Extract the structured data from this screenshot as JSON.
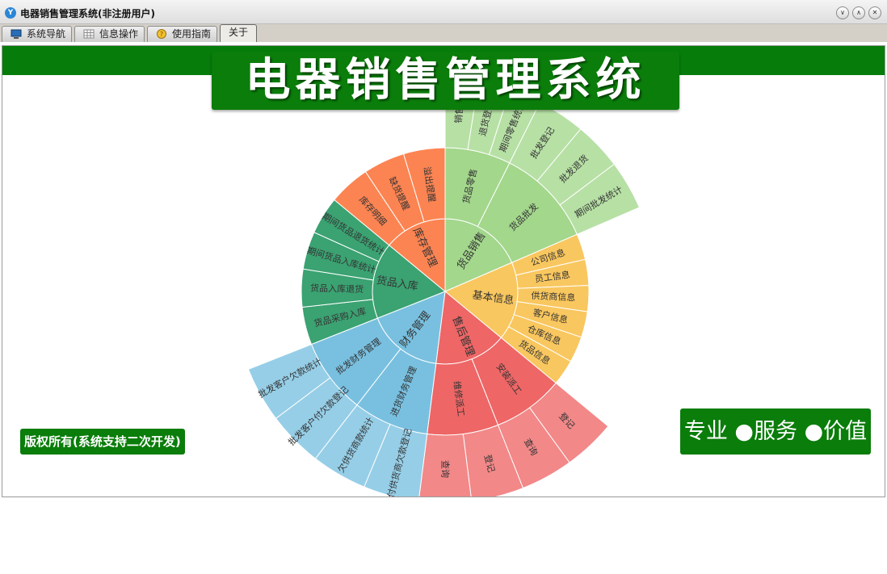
{
  "window": {
    "title": "电器销售管理系统(非注册用户)"
  },
  "tabs": [
    {
      "label": "系统导航",
      "icon": "monitor-icon"
    },
    {
      "label": "信息操作",
      "icon": "grid-icon"
    },
    {
      "label": "使用指南",
      "icon": "help-icon"
    },
    {
      "label": "关于",
      "icon": ""
    }
  ],
  "banner": {
    "title": "电器销售管理系统"
  },
  "footer": {
    "copyright": "版权所有(系统支持二次开发)",
    "slogan": "专业 ●服务 ●价值"
  },
  "colors": {
    "brand_green": "#0a7d0a"
  },
  "chart_data": {
    "type": "sunburst",
    "title": "",
    "levels": [
      {
        "name": "货品销售",
        "color": "#a3d78c",
        "share": 0.185,
        "children": [
          {
            "name": "货品零售",
            "share": 0.4,
            "children": [
              {
                "name": "销售",
                "share": 0.34
              },
              {
                "name": "退货登记",
                "share": 0.33
              },
              {
                "name": "期间零售统计",
                "share": 0.33
              }
            ]
          },
          {
            "name": "货品批发",
            "share": 0.6,
            "children": [
              {
                "name": "批发登记",
                "share": 0.33
              },
              {
                "name": "批发退货",
                "share": 0.33
              },
              {
                "name": "期间批发统计",
                "share": 0.34
              }
            ]
          }
        ]
      },
      {
        "name": "基本信息",
        "color": "#f9c75f",
        "share": 0.175,
        "children": [
          {
            "name": "公司信息"
          },
          {
            "name": "员工信息"
          },
          {
            "name": "供货商信息"
          },
          {
            "name": "客户信息"
          },
          {
            "name": "仓库信息"
          },
          {
            "name": "货品信息"
          }
        ]
      },
      {
        "name": "售后管理",
        "color": "#ee6666",
        "share": 0.16,
        "children": [
          {
            "name": "安装派工",
            "share": 0.5,
            "children": [
              {
                "name": "登记"
              },
              {
                "name": "查询"
              }
            ]
          },
          {
            "name": "维修派工",
            "share": 0.5,
            "children": [
              {
                "name": "登记"
              },
              {
                "name": "查询"
              }
            ]
          }
        ]
      },
      {
        "name": "财务管理",
        "color": "#79c0e0",
        "share": 0.17,
        "children": [
          {
            "name": "进货财务管理",
            "share": 0.5,
            "children": [
              {
                "name": "付供货商欠款登记"
              },
              {
                "name": "欠供货商款统计"
              }
            ]
          },
          {
            "name": "批发财务管理",
            "share": 0.5,
            "children": [
              {
                "name": "批发客户付欠款登记"
              },
              {
                "name": "批发客户欠款统计"
              }
            ]
          }
        ]
      },
      {
        "name": "货品入库",
        "color": "#3ba272",
        "share": 0.17,
        "children": [
          {
            "name": "货品采购入库"
          },
          {
            "name": "货品入库退货"
          },
          {
            "name": "期间货品入库统计"
          },
          {
            "name": "期间货品退货统计"
          }
        ]
      },
      {
        "name": "库存管理",
        "color": "#fc8452",
        "share": 0.14,
        "children": [
          {
            "name": "库存明细"
          },
          {
            "name": "缺货提醒"
          },
          {
            "name": "溢出提醒"
          }
        ]
      }
    ]
  }
}
